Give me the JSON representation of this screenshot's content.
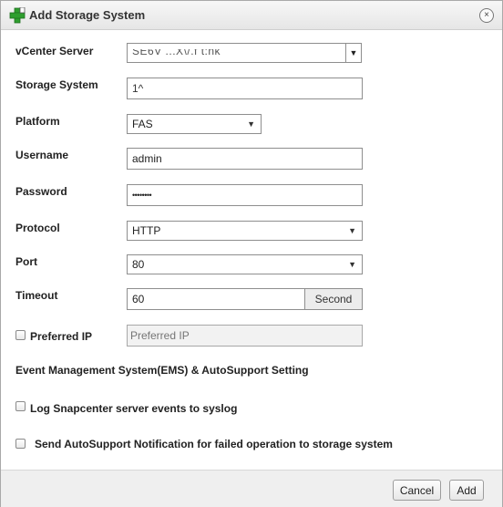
{
  "dialog": {
    "title": "Add Storage System",
    "close_glyph": "×",
    "icons": {
      "title_icon": "add-plus-icon",
      "close_icon": "close-icon"
    },
    "colors": {
      "plus_green": "#2e9e2e",
      "header_bg": "#ececec"
    }
  },
  "form": {
    "vcenter": {
      "label": "vCenter Server",
      "value": "SE6V  ...X\\/.f  t:nk"
    },
    "storage_system": {
      "label": "Storage System",
      "value": "1^"
    },
    "platform": {
      "label": "Platform",
      "value": "FAS"
    },
    "username": {
      "label": "Username",
      "value": "admin"
    },
    "password": {
      "label": "Password",
      "value": "••••••••"
    },
    "protocol": {
      "label": "Protocol",
      "value": "HTTP"
    },
    "port": {
      "label": "Port",
      "value": "80"
    },
    "timeout": {
      "label": "Timeout",
      "value": "60",
      "unit": "Second"
    },
    "preferred_ip": {
      "label": "Preferred IP",
      "placeholder": "Preferred IP",
      "checked": false
    }
  },
  "ems": {
    "heading": "Event Management System(EMS) & AutoSupport Setting",
    "log_syslog": {
      "label": "Log Snapcenter server events to syslog",
      "checked": false
    },
    "autosupport": {
      "label": "Send AutoSupport Notification for failed operation to storage system",
      "checked": false
    }
  },
  "footer": {
    "cancel_label": "Cancel",
    "add_label": "Add"
  },
  "glyphs": {
    "dropdown_arrow": "▼"
  }
}
